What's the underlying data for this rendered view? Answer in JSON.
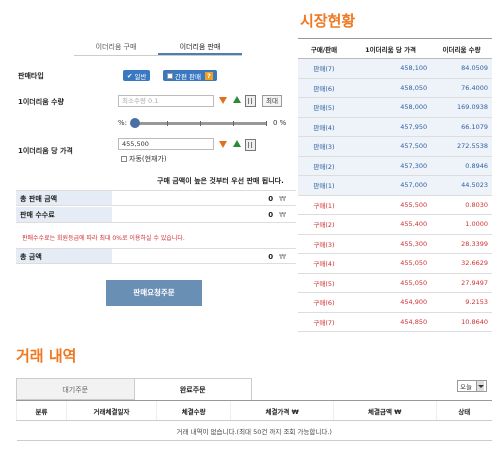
{
  "market": {
    "title": "시장현황",
    "headers": [
      "구매/판매",
      "1이더리움 당 가격",
      "이더리움 수량"
    ],
    "rows": [
      {
        "type": "판매(7)",
        "price": "458,100",
        "qty": "84.0509",
        "side": "sell"
      },
      {
        "type": "판매(6)",
        "price": "458,050",
        "qty": "76.4000",
        "side": "sell"
      },
      {
        "type": "판매(5)",
        "price": "458,000",
        "qty": "169.0938",
        "side": "sell"
      },
      {
        "type": "판매(4)",
        "price": "457,950",
        "qty": "66.1079",
        "side": "sell"
      },
      {
        "type": "판매(3)",
        "price": "457,500",
        "qty": "272.5538",
        "side": "sell"
      },
      {
        "type": "판매(2)",
        "price": "457,300",
        "qty": "0.8946",
        "side": "sell"
      },
      {
        "type": "판매(1)",
        "price": "457,000",
        "qty": "44.5023",
        "side": "sell"
      },
      {
        "type": "구매(1)",
        "price": "455,500",
        "qty": "0.8030",
        "side": "buy"
      },
      {
        "type": "구매(2)",
        "price": "455,400",
        "qty": "1.0000",
        "side": "buy"
      },
      {
        "type": "구매(3)",
        "price": "455,300",
        "qty": "28.3399",
        "side": "buy"
      },
      {
        "type": "구매(4)",
        "price": "455,050",
        "qty": "32.6629",
        "side": "buy"
      },
      {
        "type": "구매(5)",
        "price": "455,050",
        "qty": "27.9497",
        "side": "buy"
      },
      {
        "type": "구매(6)",
        "price": "454,900",
        "qty": "9.2153",
        "side": "buy"
      },
      {
        "type": "구매(7)",
        "price": "454,850",
        "qty": "10.8640",
        "side": "buy"
      }
    ]
  },
  "order": {
    "tabs": [
      "이더리움 구매",
      "이더리움 판매"
    ],
    "sell_type_label": "판매타입",
    "type_normal": "일반",
    "type_simple": "간편 판매",
    "type_help": "?",
    "qty_label": "1이더리움 수량",
    "qty_placeholder": "최소수량 0.1",
    "max_label": "최대",
    "percent_prefix": "%:",
    "percent_value": "0 %",
    "price_label": "1이더리움 당 가격",
    "price_value": "455,500",
    "auto_label": "자동(현재가)",
    "notice": "구매 금액이 높은 것부터 우선 판매 됩니다.",
    "total_sell_label": "총 판매 금액",
    "total_sell_value": "0",
    "fee_label": "판매 수수료",
    "fee_value": "0",
    "currency": "₩",
    "fee_note": "판매수수료는 회원등급에 따라 최대 0%로 이용하실 수 있습니다.",
    "total_label": "총 금액",
    "total_value": "0",
    "submit_label": "판매요청주문"
  },
  "history": {
    "title": "거래 내역",
    "tabs": [
      "대기주문",
      "완료주문"
    ],
    "period": "오늘",
    "headers": [
      "분류",
      "거래체결일자",
      "체결수량",
      "체결가격 ₩",
      "체결금액 ₩",
      "상태"
    ],
    "empty": "거래 내역이 없습니다.(최대 50건 까지 조회 가능합니다.)"
  }
}
